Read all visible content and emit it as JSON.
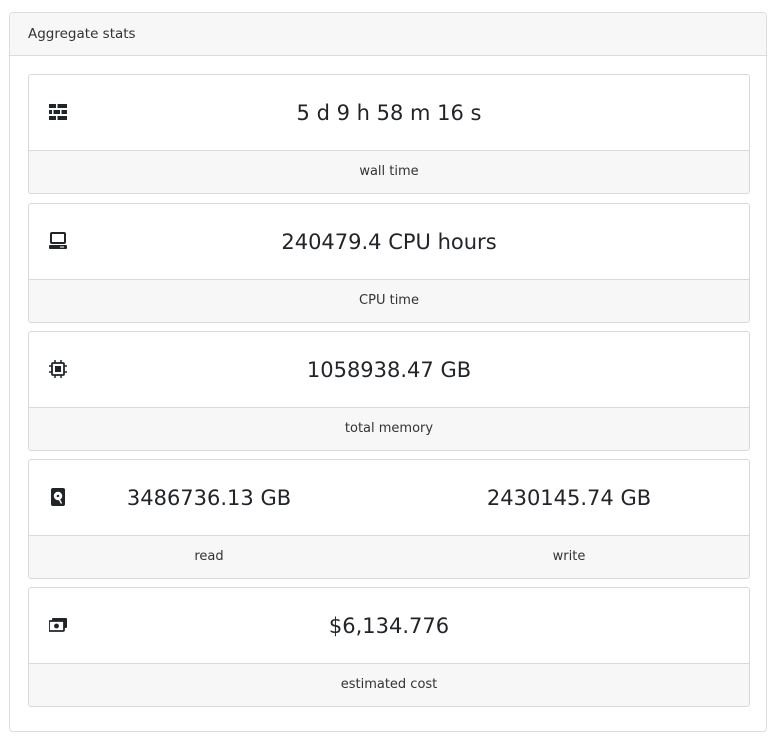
{
  "panel": {
    "title": "Aggregate stats"
  },
  "cards": {
    "wall": {
      "value": "5 d 9 h 58 m 16 s",
      "label": "wall time",
      "icon": "wall-time-icon"
    },
    "cpu": {
      "value": "240479.4 CPU hours",
      "label": "CPU time",
      "icon": "computer-icon"
    },
    "memory": {
      "value": "1058938.47 GB",
      "label": "total memory",
      "icon": "memory-chip-icon"
    },
    "io": {
      "read_value": "3486736.13 GB",
      "write_value": "2430145.74 GB",
      "read_label": "read",
      "write_label": "write",
      "icon": "hard-disk-icon"
    },
    "cost": {
      "value": "$6,134.776",
      "label": "estimated cost",
      "icon": "money-icon"
    }
  }
}
